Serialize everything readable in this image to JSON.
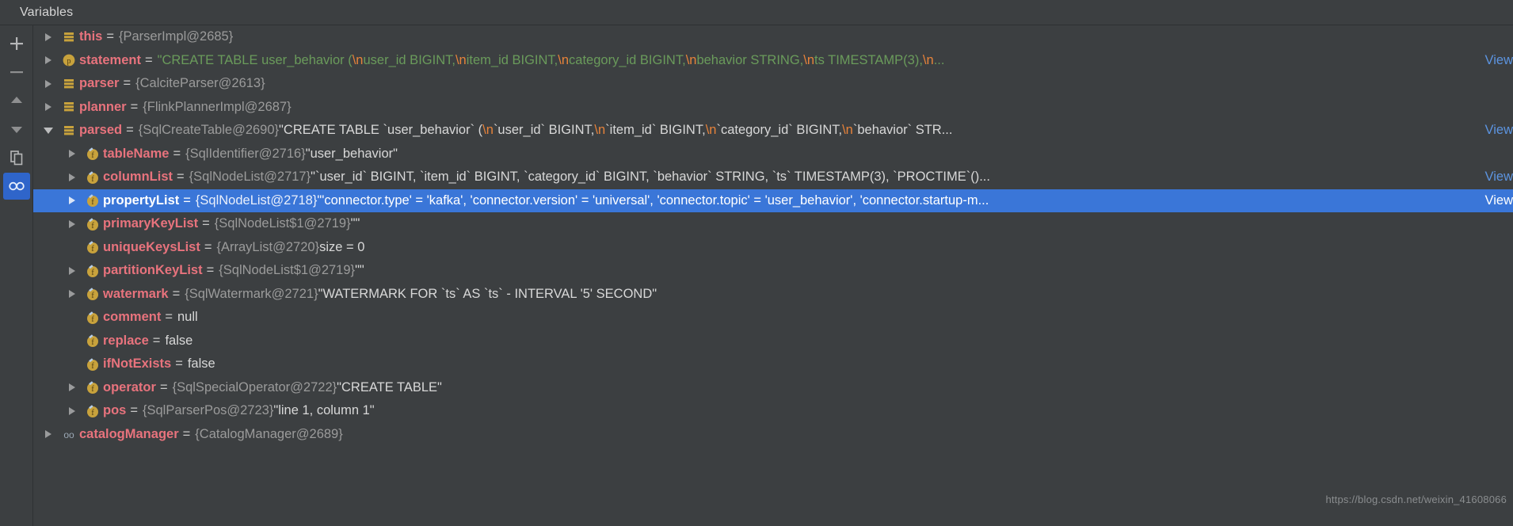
{
  "window": {
    "tab_label": "Variables",
    "watermark": "https://blog.csdn.net/weixin_41608066"
  },
  "toolbar": {
    "items": [
      {
        "name": "add-watch-button",
        "icon": "plus-icon",
        "label": "+"
      },
      {
        "name": "remove-watch-button",
        "icon": "minus-icon",
        "label": "−"
      },
      {
        "name": "move-up-button",
        "icon": "chevron-up-icon",
        "label": "▲"
      },
      {
        "name": "move-down-button",
        "icon": "chevron-down-icon",
        "label": "▼"
      },
      {
        "name": "copy-value-button",
        "icon": "copy-icon",
        "label": "Copy"
      },
      {
        "name": "watches-button",
        "icon": "glasses-icon",
        "label": "Watches",
        "selected": true
      }
    ]
  },
  "colors": {
    "background": "#3c3f41",
    "selection": "#3a76d8",
    "variable_name": "#e8737d",
    "type_text": "#9b9b9b",
    "string_value": "#6a9b5b",
    "escape": "#e8833a",
    "link": "#5c94e0",
    "accent_icon": "#c8a23c"
  },
  "view_link_label": "View",
  "rows": [
    {
      "name": "this",
      "depth": 0,
      "twisty": "collapsed",
      "icon": "local-variable-icon",
      "type": "{ParserImpl@2685}",
      "value": "",
      "value_kind": "none",
      "view_link": false,
      "selected": false
    },
    {
      "name": "statement",
      "depth": 0,
      "twisty": "collapsed",
      "icon": "parameter-icon",
      "type": "",
      "value": "\"CREATE TABLE user_behavior (\\n    user_id BIGINT,\\n    item_id BIGINT,\\n    category_id BIGINT,\\n    behavior STRING,\\n    ts TIMESTAMP(3),\\n ...",
      "value_kind": "sql-string",
      "view_link": true,
      "selected": false
    },
    {
      "name": "parser",
      "depth": 0,
      "twisty": "collapsed",
      "icon": "local-variable-icon",
      "type": "{CalciteParser@2613}",
      "value": "",
      "value_kind": "none",
      "view_link": false,
      "selected": false
    },
    {
      "name": "planner",
      "depth": 0,
      "twisty": "collapsed",
      "icon": "local-variable-icon",
      "type": "{FlinkPlannerImpl@2687}",
      "value": "",
      "value_kind": "none",
      "view_link": false,
      "selected": false
    },
    {
      "name": "parsed",
      "depth": 0,
      "twisty": "expanded",
      "icon": "local-variable-icon",
      "type": "{SqlCreateTable@2690}",
      "value": "\"CREATE TABLE `user_behavior` (\\n  `user_id`  BIGINT,\\n  `item_id`  BIGINT,\\n  `category_id`  BIGINT,\\n  `behavior`  STR...",
      "value_kind": "plain-string",
      "view_link": true,
      "selected": false
    },
    {
      "name": "tableName",
      "depth": 1,
      "twisty": "collapsed",
      "icon": "field-icon",
      "type": "{SqlIdentifier@2716}",
      "value": "\"user_behavior\"",
      "value_kind": "plain-string",
      "view_link": false,
      "selected": false
    },
    {
      "name": "columnList",
      "depth": 1,
      "twisty": "collapsed",
      "icon": "field-icon",
      "type": "{SqlNodeList@2717}",
      "value": "\"`user_id`  BIGINT, `item_id`  BIGINT, `category_id`  BIGINT, `behavior`  STRING, `ts`  TIMESTAMP(3), `PROCTIME`()...",
      "value_kind": "plain-string",
      "view_link": true,
      "selected": false
    },
    {
      "name": "propertyList",
      "depth": 1,
      "twisty": "collapsed",
      "icon": "field-icon",
      "type": "{SqlNodeList@2718}",
      "value": "\"'connector.type' = 'kafka', 'connector.version' = 'universal', 'connector.topic' = 'user_behavior', 'connector.startup-m...",
      "value_kind": "plain-string",
      "view_link": true,
      "selected": true
    },
    {
      "name": "primaryKeyList",
      "depth": 1,
      "twisty": "collapsed",
      "icon": "field-icon",
      "type": "{SqlNodeList$1@2719}",
      "value": "\"\"",
      "value_kind": "plain-string",
      "view_link": false,
      "selected": false
    },
    {
      "name": "uniqueKeysList",
      "depth": 1,
      "twisty": "none",
      "icon": "field-icon",
      "type": "{ArrayList@2720}",
      "value": "size = 0",
      "value_kind": "plain",
      "view_link": false,
      "selected": false
    },
    {
      "name": "partitionKeyList",
      "depth": 1,
      "twisty": "collapsed",
      "icon": "field-icon",
      "type": "{SqlNodeList$1@2719}",
      "value": "\"\"",
      "value_kind": "plain-string",
      "view_link": false,
      "selected": false
    },
    {
      "name": "watermark",
      "depth": 1,
      "twisty": "collapsed",
      "icon": "field-icon",
      "type": "{SqlWatermark@2721}",
      "value": "\"WATERMARK FOR `ts` AS `ts` - INTERVAL '5' SECOND\"",
      "value_kind": "plain-string",
      "view_link": false,
      "selected": false
    },
    {
      "name": "comment",
      "depth": 1,
      "twisty": "none",
      "icon": "field-icon",
      "type": "",
      "value": "null",
      "value_kind": "plain",
      "view_link": false,
      "selected": false
    },
    {
      "name": "replace",
      "depth": 1,
      "twisty": "none",
      "icon": "field-icon",
      "type": "",
      "value": "false",
      "value_kind": "plain",
      "view_link": false,
      "selected": false
    },
    {
      "name": "ifNotExists",
      "depth": 1,
      "twisty": "none",
      "icon": "field-icon",
      "type": "",
      "value": "false",
      "value_kind": "plain",
      "view_link": false,
      "selected": false
    },
    {
      "name": "operator",
      "depth": 1,
      "twisty": "collapsed",
      "icon": "field-icon",
      "type": "{SqlSpecialOperator@2722}",
      "value": "\"CREATE TABLE\"",
      "value_kind": "plain-string",
      "view_link": false,
      "selected": false
    },
    {
      "name": "pos",
      "depth": 1,
      "twisty": "collapsed",
      "icon": "field-icon",
      "type": "{SqlParserPos@2723}",
      "value": "\"line 1, column 1\"",
      "value_kind": "plain-string",
      "view_link": false,
      "selected": false
    },
    {
      "name": "catalogManager",
      "depth": 0,
      "twisty": "collapsed",
      "icon": "static-field-icon",
      "type": "{CatalogManager@2689}",
      "value": "",
      "value_kind": "none",
      "view_link": false,
      "selected": false
    }
  ],
  "statement_tokens": [
    {
      "t": "\"CREATE TABLE user_behavior (",
      "k": "s"
    },
    {
      "t": "\\n",
      "k": "e"
    },
    {
      "t": "    user_id BIGINT,",
      "k": "s"
    },
    {
      "t": "\\n",
      "k": "e"
    },
    {
      "t": "    item_id BIGINT,",
      "k": "s"
    },
    {
      "t": "\\n",
      "k": "e"
    },
    {
      "t": "    category_id BIGINT,",
      "k": "s"
    },
    {
      "t": "\\n",
      "k": "e"
    },
    {
      "t": "    behavior STRING,",
      "k": "s"
    },
    {
      "t": "\\n",
      "k": "e"
    },
    {
      "t": "    ts TIMESTAMP(3),",
      "k": "s"
    },
    {
      "t": "\\n",
      "k": "e"
    },
    {
      "t": " ...",
      "k": "s"
    }
  ],
  "parsed_tokens": [
    {
      "t": "\"CREATE TABLE `user_behavior` (",
      "k": "v"
    },
    {
      "t": "\\n",
      "k": "e"
    },
    {
      "t": "  `user_id`  BIGINT,",
      "k": "v"
    },
    {
      "t": "\\n",
      "k": "e"
    },
    {
      "t": "  `item_id`  BIGINT,",
      "k": "v"
    },
    {
      "t": "\\n",
      "k": "e"
    },
    {
      "t": "  `category_id`  BIGINT,",
      "k": "v"
    },
    {
      "t": "\\n",
      "k": "e"
    },
    {
      "t": "  `behavior`  STR...",
      "k": "v"
    }
  ]
}
